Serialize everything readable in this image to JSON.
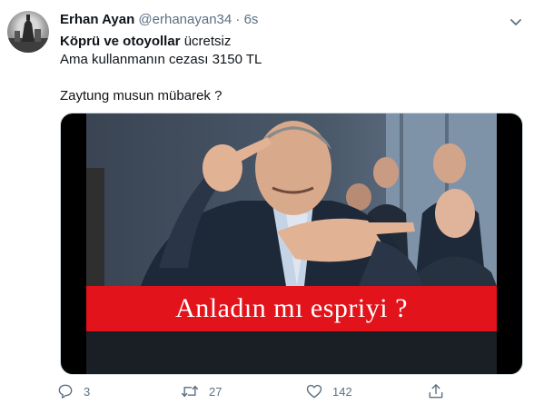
{
  "tweet": {
    "author_name": "Erhan Ayan",
    "author_handle": "@erhanayan34",
    "separator": "·",
    "time": "6s",
    "lines": {
      "line1_bold": "Köprü ve otoyollar",
      "line1_rest": " ücretsiz",
      "line2": "Ama kullanmanın cezası 3150 TL",
      "line3": "Zaytung musun mübarek ?"
    },
    "image_caption": "Anladın mı espriyi ?",
    "actions": {
      "replies": "3",
      "retweets": "27",
      "likes": "142"
    },
    "icons": {
      "caret": "chevron-down-icon",
      "reply": "reply-icon",
      "retweet": "retweet-icon",
      "like": "heart-icon",
      "share": "share-icon"
    },
    "colors": {
      "secondary_text": "#5b7083",
      "banner_red": "#e3131b"
    }
  }
}
